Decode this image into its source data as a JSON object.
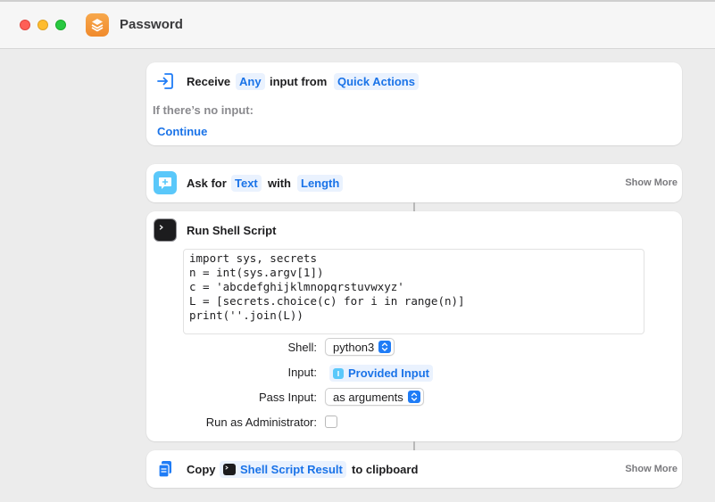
{
  "window": {
    "title": "Password"
  },
  "receive": {
    "label": "Receive",
    "type_token": "Any",
    "mid": "input from",
    "source_token": "Quick Actions",
    "no_input_label": "If there’s no input:",
    "no_input_action": "Continue"
  },
  "ask": {
    "label": "Ask for",
    "type_token": "Text",
    "mid": "with",
    "prompt_token": "Length",
    "show_more": "Show More"
  },
  "shell": {
    "title": "Run Shell Script",
    "code_lines": [
      "import sys, secrets",
      "n = int(sys.argv[1])",
      "c = 'abcdefghijklmnopqrstuvwxyz'",
      "L = [secrets.choice(c) for i in range(n)]",
      "print(''.join(L))"
    ],
    "shell_label": "Shell:",
    "shell_value": "python3",
    "input_label": "Input:",
    "input_value": "Provided Input",
    "pass_label": "Pass Input:",
    "pass_value": "as arguments",
    "admin_label": "Run as Administrator:",
    "admin_checked": false
  },
  "copy": {
    "label": "Copy",
    "token": "Shell Script Result",
    "suffix": "to clipboard",
    "show_more": "Show More"
  },
  "colors": {
    "accent": "#1a73e8",
    "token_bg": "#eaf2fe",
    "app_icon": "#f08a2c",
    "receive_icon": "#1f7cf6",
    "ask_icon": "#5ac8fa"
  }
}
